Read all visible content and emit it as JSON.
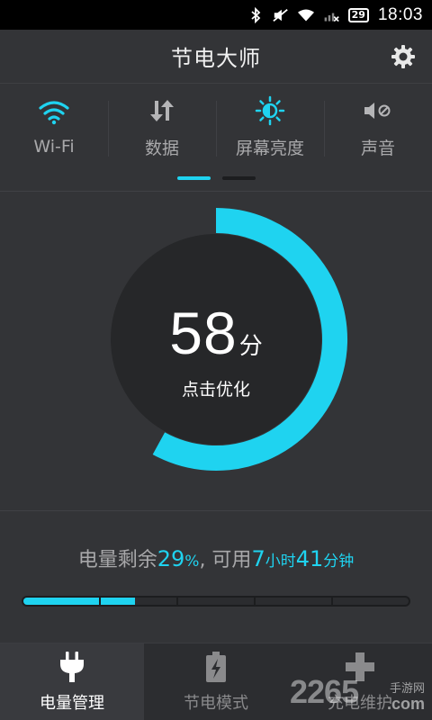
{
  "status_bar": {
    "battery_badge": "29",
    "time": "18:03",
    "icons": [
      "bluetooth-icon",
      "mute-icon",
      "wifi-icon",
      "signal-icon",
      "battery-icon"
    ]
  },
  "header": {
    "title": "节电大师",
    "settings_icon": "gear-icon"
  },
  "toggles": [
    {
      "label": "Wi-Fi",
      "icon": "wifi-icon",
      "active": true
    },
    {
      "label": "数据",
      "icon": "data-transfer-icon",
      "active": false
    },
    {
      "label": "屏幕亮度",
      "icon": "brightness-icon",
      "active": true
    },
    {
      "label": "声音",
      "icon": "mute-icon",
      "active": false
    }
  ],
  "pager": {
    "current_page": 1,
    "total_pages": 2
  },
  "gauge": {
    "score": "58",
    "unit": "分",
    "action_label": "点击优化",
    "progress_fraction": 0.58,
    "accent_color": "#1fd3f0"
  },
  "battery": {
    "prefix": "电量剩余",
    "percent": "29",
    "percent_sign": "%",
    "middle": ", 可用",
    "hours": "7",
    "hours_unit": "小时",
    "minutes": "41",
    "minutes_unit": "分钟",
    "level_fraction": 0.29
  },
  "bottom_nav": [
    {
      "label": "电量管理",
      "icon": "plug-icon",
      "active": true
    },
    {
      "label": "节电模式",
      "icon": "battery-bolt-icon",
      "active": false
    },
    {
      "label": "充电维护",
      "icon": "plus-icon",
      "active": false
    }
  ],
  "watermark": {
    "brand": "2265",
    "tagline": "手游网",
    "domain": ".com"
  }
}
